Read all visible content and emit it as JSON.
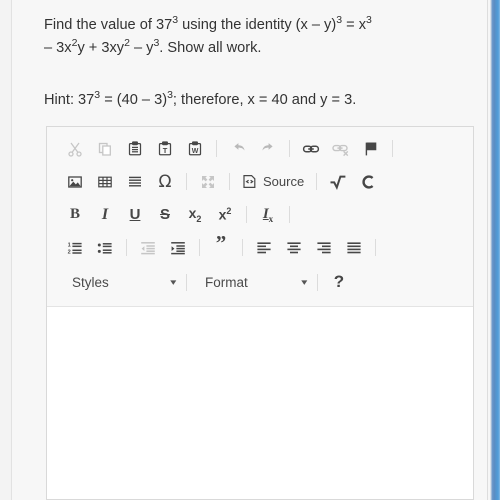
{
  "question": {
    "line1_pre": "Find the value of 37",
    "line1_sup": "3",
    "line1_mid": " using the identity (x – y)",
    "line1_sup2": "3",
    "line1_eq": " = x",
    "line1_sup3": "3",
    "line2_a": "– 3x",
    "line2_sup1": "2",
    "line2_b": "y + 3xy",
    "line2_sup2": "2",
    "line2_c": " – y",
    "line2_sup3": "3",
    "line2_d": ". Show all work."
  },
  "hint": {
    "a": "Hint: 37",
    "sup1": "3",
    "b": " = (40 – 3)",
    "sup2": "3",
    "c": "; therefore, x = 40 and y = 3."
  },
  "editor": {
    "toolbar": {
      "row1": [
        {
          "name": "cut-icon",
          "title": "Cut",
          "disabled": true
        },
        {
          "name": "copy-icon",
          "title": "Copy",
          "disabled": true
        },
        {
          "name": "paste-icon",
          "title": "Paste",
          "disabled": false
        },
        {
          "name": "paste-as-plain-text-icon",
          "title": "Paste as plain text",
          "disabled": false
        },
        {
          "name": "paste-from-word-icon",
          "title": "Paste from Word",
          "disabled": false
        },
        {
          "name": "undo-icon",
          "title": "Undo",
          "disabled": true
        },
        {
          "name": "redo-icon",
          "title": "Redo",
          "disabled": true
        },
        {
          "name": "link-icon",
          "title": "Link",
          "disabled": false
        },
        {
          "name": "unlink-icon",
          "title": "Unlink",
          "disabled": true
        },
        {
          "name": "anchor-flag-icon",
          "title": "Anchor",
          "disabled": false
        }
      ],
      "row2": [
        {
          "name": "image-icon",
          "title": "Image",
          "disabled": false
        },
        {
          "name": "table-icon",
          "title": "Table",
          "disabled": false
        },
        {
          "name": "horizontal-rule-icon",
          "title": "Horizontal line",
          "disabled": false
        },
        {
          "name": "special-character-icon",
          "title": "Insert special character",
          "disabled": false,
          "glyph": "Ω"
        },
        {
          "name": "maximize-icon",
          "title": "Maximize",
          "disabled": true
        },
        {
          "name": "source-icon",
          "title": "Source",
          "disabled": false
        },
        {
          "name": "math-sqrt-icon",
          "title": "Math formula",
          "disabled": false,
          "glyph": "√"
        },
        {
          "name": "chemistry-icon",
          "title": "Chemistry formula",
          "disabled": false,
          "glyph": "C"
        }
      ],
      "source_label": "Source",
      "row3": [
        {
          "name": "bold-icon",
          "title": "Bold",
          "glyph": "B"
        },
        {
          "name": "italic-icon",
          "title": "Italic",
          "glyph": "I"
        },
        {
          "name": "underline-icon",
          "title": "Underline",
          "glyph": "U"
        },
        {
          "name": "strikethrough-icon",
          "title": "Strikethrough",
          "glyph": "S"
        },
        {
          "name": "subscript-icon",
          "title": "Subscript",
          "glyph": "x",
          "affix": "2"
        },
        {
          "name": "superscript-icon",
          "title": "Superscript",
          "glyph": "x",
          "affix": "2"
        },
        {
          "name": "remove-format-icon",
          "title": "Remove Format",
          "glyph": "I",
          "affix": "x"
        }
      ],
      "row4": [
        {
          "name": "numbered-list-icon",
          "title": "Insert/Remove Numbered List",
          "disabled": false
        },
        {
          "name": "bulleted-list-icon",
          "title": "Insert/Remove Bulleted List",
          "disabled": false
        },
        {
          "name": "decrease-indent-icon",
          "title": "Decrease Indent",
          "disabled": true
        },
        {
          "name": "increase-indent-icon",
          "title": "Increase Indent",
          "disabled": false
        },
        {
          "name": "blockquote-icon",
          "title": "Block Quote",
          "disabled": false,
          "glyph": "”"
        },
        {
          "name": "align-left-icon",
          "title": "Align Left",
          "disabled": false
        },
        {
          "name": "align-center-icon",
          "title": "Center",
          "disabled": false
        },
        {
          "name": "align-right-icon",
          "title": "Align Right",
          "disabled": false
        },
        {
          "name": "justify-icon",
          "title": "Justify",
          "disabled": false
        }
      ],
      "styles_label": "Styles",
      "format_label": "Format",
      "caret_glyph": "▾",
      "help_glyph": "?"
    },
    "body_text": ""
  },
  "colors": {
    "page_background": "#f3f3f3",
    "card_background": "#f7f7f7",
    "toolbar_background": "#f8f8f8",
    "editor_background": "#ffffff",
    "border": "#d9d9d9",
    "text": "#333333",
    "icon": "#474747",
    "icon_disabled": "#c6c6c6",
    "accent_stripe": "#5b8cc2"
  }
}
